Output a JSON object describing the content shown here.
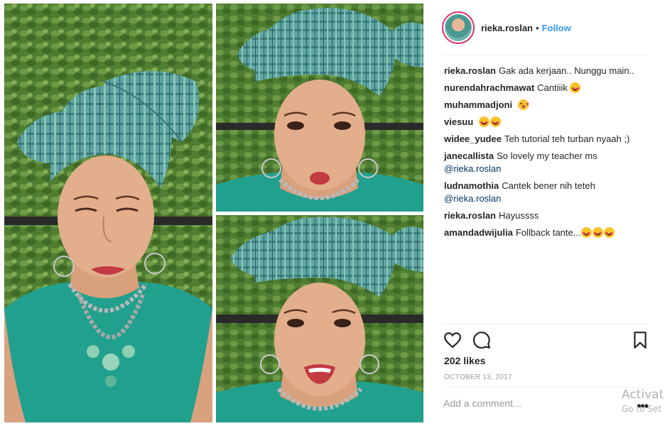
{
  "post": {
    "username": "rieka.roslan",
    "separator": "•",
    "follow_label": "Follow",
    "likes": "202 likes",
    "date": "OCTOBER 13, 2017"
  },
  "comments": [
    {
      "user": "rieka.roslan",
      "text": "Gak ada kerjaan.. Nunggu main..",
      "emojis": []
    },
    {
      "user": "nurendahrachmawat",
      "text": "Cantiiik",
      "emojis": [
        "heart-eyes"
      ]
    },
    {
      "user": "muhammadjoni",
      "text": "",
      "emojis": [
        "kiss"
      ]
    },
    {
      "user": "viesuu",
      "text": "",
      "emojis": [
        "heart-eyes",
        "heart-eyes"
      ]
    },
    {
      "user": "widee_yudee",
      "text": "Teh tutorial teh turban nyaah ;)",
      "emojis": []
    },
    {
      "user": "janecallista",
      "text": "So lovely my teacher ms",
      "mention": "@rieka.roslan",
      "emojis": []
    },
    {
      "user": "ludnamothia",
      "text": "Cantek bener nih teteh",
      "mention": "@rieka.roslan",
      "emojis": []
    },
    {
      "user": "rieka.roslan",
      "text": "Hayussss",
      "emojis": []
    },
    {
      "user": "amandadwijulia",
      "text": "Follback tante...",
      "emojis": [
        "heart-eyes",
        "heart-eyes",
        "heart-eyes"
      ]
    }
  ],
  "comment_input": {
    "placeholder": "Add a comment...",
    "more_icon": "•••"
  },
  "watermark": {
    "line1": "Activat",
    "line2": "Go to Set"
  },
  "icons": {
    "like": "heart-outline-icon",
    "comment": "speech-bubble-icon",
    "save": "bookmark-icon",
    "more": "more-options-icon"
  },
  "colors": {
    "follow": "#3897f0",
    "mention": "#003569",
    "muted": "#999999",
    "avatar_ring": "#e1306c",
    "scarf": "#4f9f98",
    "top": "#1f9c8c",
    "hedge": "#5b8a3a"
  }
}
